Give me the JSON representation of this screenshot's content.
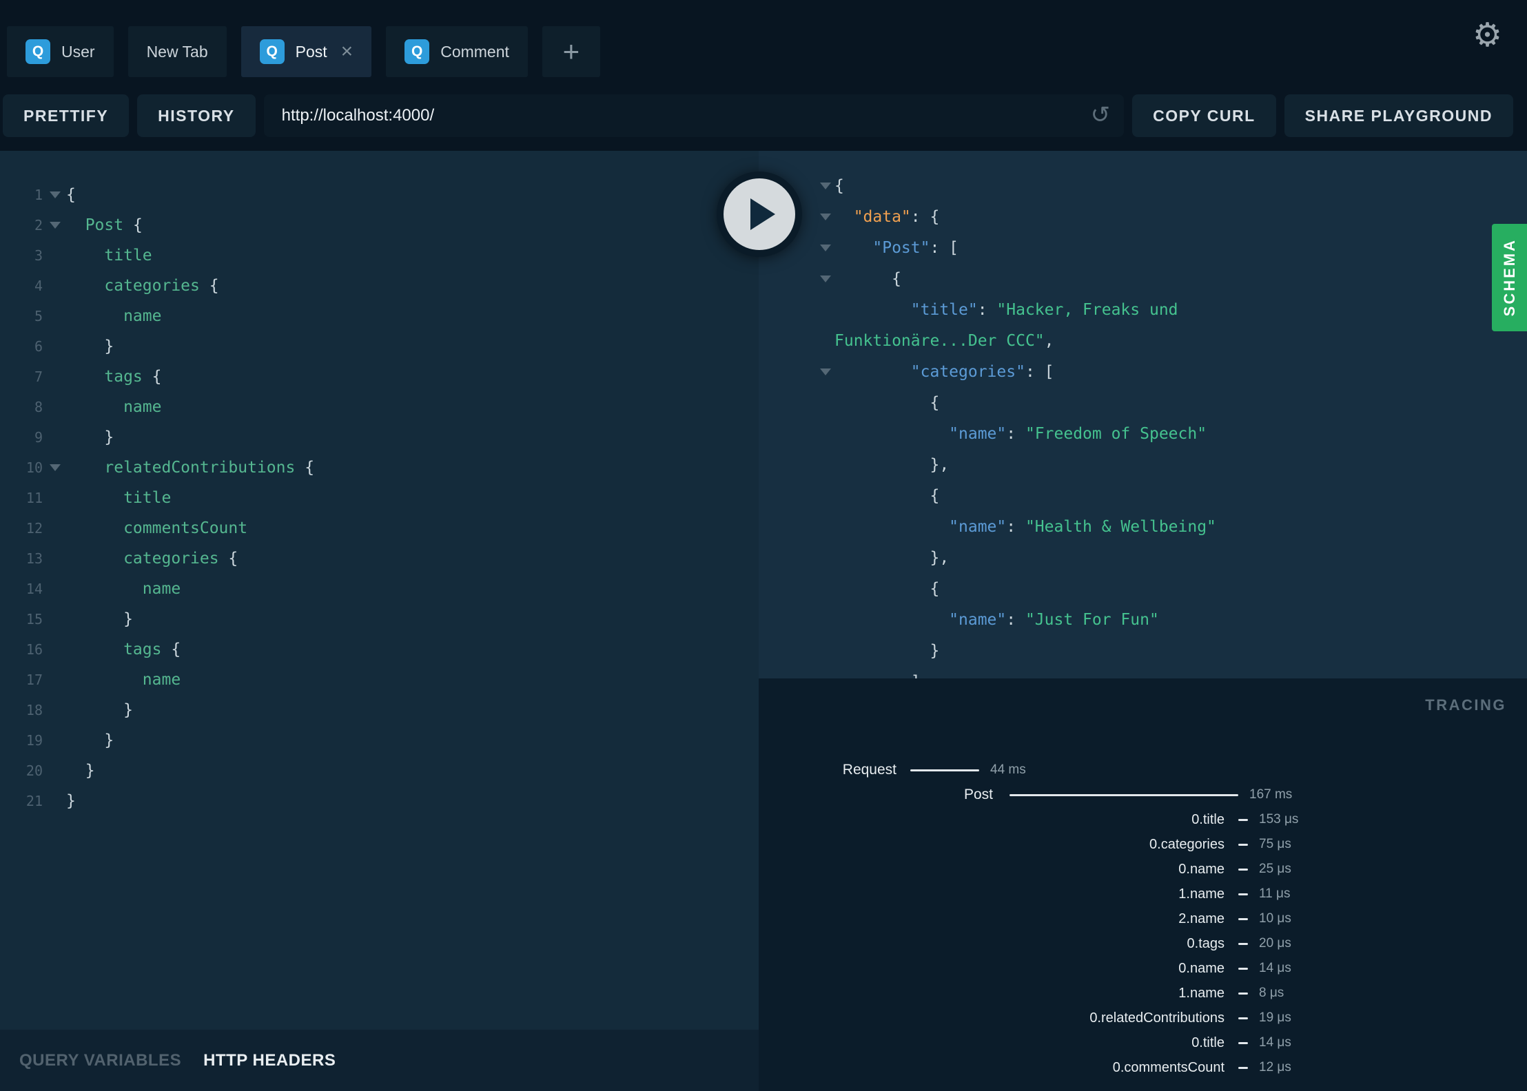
{
  "colors": {
    "header-bg": "#081521",
    "tab-bg": "#0e1f2b",
    "tab-active-bg": "#172a3d",
    "button-bg": "#102330",
    "url-bg": "#0b1a26",
    "editor-bg": "#142b3b",
    "response-bg": "#172f41",
    "tracing-bg": "#0b1c2a",
    "bottombar-bg": "#0f2231",
    "accent-q": "#2d9cdb",
    "schema-green": "#27ae60",
    "field-green": "#55b790",
    "string-green": "#45c28f",
    "key-blue": "#5c9bd6",
    "data-orange": "#f0a050",
    "punct": "#ccd7dd",
    "linenum": "#4d6170",
    "fold": "#546775",
    "bar-white": "#e3e8ec",
    "time-gray": "#90a0aa",
    "trace-title": "#5c6e7b",
    "qv-dim": "#52626e"
  },
  "header": {
    "tabs": [
      {
        "label": "User",
        "badge": "Q"
      },
      {
        "label": "New Tab"
      },
      {
        "label": "Post",
        "badge": "Q",
        "close": "×",
        "active": true
      },
      {
        "label": "Comment",
        "badge": "Q"
      }
    ],
    "new_tab_button": "+",
    "settings_icon": "⚙"
  },
  "toolbar": {
    "prettify_label": "PRETTIFY",
    "history_label": "HISTORY",
    "url_value": "http://localhost:4000/",
    "reload_icon": "↺",
    "copy_curl_label": "COPY CURL",
    "share_label": "SHARE PLAYGROUND"
  },
  "query_editor": {
    "lines": [
      {
        "n": 1,
        "fold": true,
        "parts": [
          [
            "p",
            "{"
          ]
        ]
      },
      {
        "n": 2,
        "fold": true,
        "parts": [
          [
            "f",
            "  Post "
          ],
          [
            "p",
            "{"
          ]
        ]
      },
      {
        "n": 3,
        "parts": [
          [
            "f",
            "    title"
          ]
        ]
      },
      {
        "n": 4,
        "parts": [
          [
            "f",
            "    categories "
          ],
          [
            "p",
            "{"
          ]
        ]
      },
      {
        "n": 5,
        "parts": [
          [
            "f",
            "      name"
          ]
        ]
      },
      {
        "n": 6,
        "parts": [
          [
            "p",
            "    }"
          ]
        ]
      },
      {
        "n": 7,
        "parts": [
          [
            "f",
            "    tags "
          ],
          [
            "p",
            "{"
          ]
        ]
      },
      {
        "n": 8,
        "parts": [
          [
            "f",
            "      name"
          ]
        ]
      },
      {
        "n": 9,
        "parts": [
          [
            "p",
            "    }"
          ]
        ]
      },
      {
        "n": 10,
        "fold": true,
        "parts": [
          [
            "f",
            "    relatedContributions "
          ],
          [
            "p",
            "{"
          ]
        ]
      },
      {
        "n": 11,
        "parts": [
          [
            "f",
            "      title"
          ]
        ]
      },
      {
        "n": 12,
        "parts": [
          [
            "f",
            "      commentsCount"
          ]
        ]
      },
      {
        "n": 13,
        "parts": [
          [
            "f",
            "      categories "
          ],
          [
            "p",
            "{"
          ]
        ]
      },
      {
        "n": 14,
        "parts": [
          [
            "f",
            "        name"
          ]
        ]
      },
      {
        "n": 15,
        "parts": [
          [
            "p",
            "      }"
          ]
        ]
      },
      {
        "n": 16,
        "parts": [
          [
            "f",
            "      tags "
          ],
          [
            "p",
            "{"
          ]
        ]
      },
      {
        "n": 17,
        "parts": [
          [
            "f",
            "        name"
          ]
        ]
      },
      {
        "n": 18,
        "parts": [
          [
            "p",
            "      }"
          ]
        ]
      },
      {
        "n": 19,
        "parts": [
          [
            "p",
            "    }"
          ]
        ]
      },
      {
        "n": 20,
        "parts": [
          [
            "p",
            "  }"
          ]
        ]
      },
      {
        "n": 21,
        "parts": [
          [
            "p",
            "}"
          ]
        ]
      }
    ]
  },
  "response": {
    "lines": [
      {
        "fold": true,
        "parts": [
          [
            "p",
            "{"
          ]
        ]
      },
      {
        "fold": true,
        "parts": [
          [
            "ko",
            "  \"data\""
          ],
          [
            "p",
            ": {"
          ]
        ]
      },
      {
        "fold": true,
        "parts": [
          [
            "kb",
            "    \"Post\""
          ],
          [
            "p",
            ": ["
          ]
        ]
      },
      {
        "fold": true,
        "parts": [
          [
            "p",
            "      {"
          ]
        ]
      },
      {
        "parts": [
          [
            "kb",
            "        \"title\""
          ],
          [
            "p",
            ": "
          ],
          [
            "s",
            "\"Hacker, Freaks und"
          ]
        ]
      },
      {
        "parts": [
          [
            "s",
            "Funktionäre...Der CCC\""
          ],
          [
            "p",
            ","
          ]
        ]
      },
      {
        "fold": true,
        "parts": [
          [
            "kb",
            "        \"categories\""
          ],
          [
            "p",
            ": ["
          ]
        ]
      },
      {
        "parts": [
          [
            "p",
            "          {"
          ]
        ]
      },
      {
        "parts": [
          [
            "kb",
            "            \"name\""
          ],
          [
            "p",
            ": "
          ],
          [
            "s",
            "\"Freedom of Speech\""
          ]
        ]
      },
      {
        "parts": [
          [
            "p",
            "          },"
          ]
        ]
      },
      {
        "parts": [
          [
            "p",
            "          {"
          ]
        ]
      },
      {
        "parts": [
          [
            "kb",
            "            \"name\""
          ],
          [
            "p",
            ": "
          ],
          [
            "s",
            "\"Health & Wellbeing\""
          ]
        ]
      },
      {
        "parts": [
          [
            "p",
            "          },"
          ]
        ]
      },
      {
        "parts": [
          [
            "p",
            "          {"
          ]
        ]
      },
      {
        "parts": [
          [
            "kb",
            "            \"name\""
          ],
          [
            "p",
            ": "
          ],
          [
            "s",
            "\"Just For Fun\""
          ]
        ]
      },
      {
        "parts": [
          [
            "p",
            "          }"
          ]
        ]
      },
      {
        "parts": [
          [
            "p",
            "        ]"
          ]
        ]
      }
    ]
  },
  "tracing": {
    "title": "TRACING",
    "request": {
      "label": "Request",
      "time": "44 ms"
    },
    "post": {
      "label": "Post",
      "time": "167 ms"
    },
    "rows": [
      {
        "label": "0.title",
        "time": "153 μs"
      },
      {
        "label": "0.categories",
        "time": "75 μs"
      },
      {
        "label": "0.name",
        "time": "25 μs"
      },
      {
        "label": "1.name",
        "time": "11 μs"
      },
      {
        "label": "2.name",
        "time": "10 μs"
      },
      {
        "label": "0.tags",
        "time": "20 μs"
      },
      {
        "label": "0.name",
        "time": "14 μs"
      },
      {
        "label": "1.name",
        "time": "8 μs"
      },
      {
        "label": "0.relatedContributions",
        "time": "19 μs"
      },
      {
        "label": "0.title",
        "time": "14 μs"
      },
      {
        "label": "0.commentsCount",
        "time": "12 μs"
      }
    ]
  },
  "bottom_bar": {
    "query_variables": "QUERY VARIABLES",
    "http_headers": "HTTP HEADERS"
  },
  "schema_tab": {
    "label": "SCHEMA"
  }
}
